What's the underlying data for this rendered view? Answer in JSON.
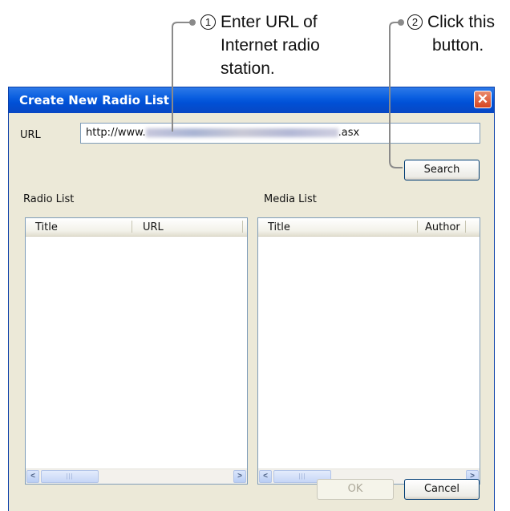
{
  "annotations": {
    "step1": {
      "number": "1",
      "text_lines": [
        "Enter URL of",
        "Internet radio",
        "station."
      ]
    },
    "step2": {
      "number": "2",
      "text_lines": [
        "Click this",
        "button."
      ]
    }
  },
  "dialog": {
    "title": "Create New Radio List",
    "close_glyph": "✕",
    "url_label": "URL",
    "url_prefix": "http://www.",
    "url_suffix": ".asx",
    "search_label": "Search",
    "radio_list": {
      "label": "Radio List",
      "columns": [
        "Title",
        "URL"
      ],
      "rows": []
    },
    "media_list": {
      "label": "Media List",
      "columns": [
        "Title",
        "Author"
      ],
      "rows": []
    },
    "scroll_left_glyph": "<",
    "scroll_right_glyph": ">",
    "scroll_thumb_glyph": "|||",
    "ok_label": "OK",
    "cancel_label": "Cancel",
    "ok_enabled": false
  },
  "colors": {
    "titlebar": "#0a5ee0",
    "dialog_bg": "#ece9d8",
    "close_button": "#d6451f"
  }
}
